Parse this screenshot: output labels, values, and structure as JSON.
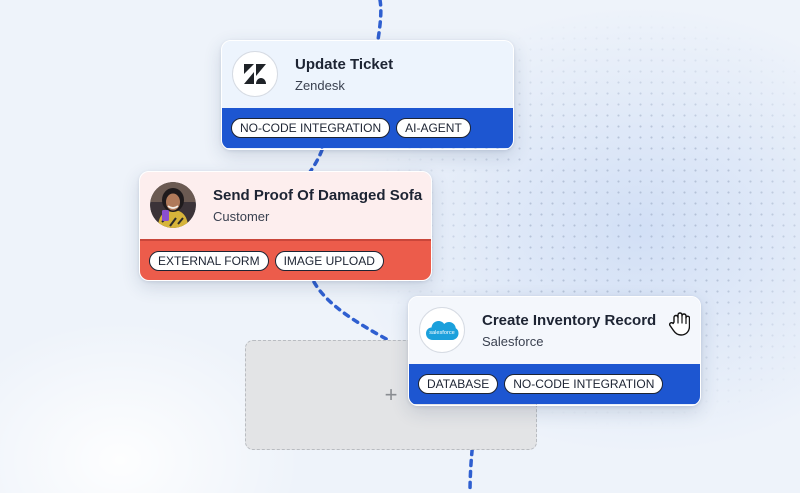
{
  "cards": [
    {
      "title": "Update Ticket",
      "subtitle": "Zendesk",
      "icon": "zendesk-logo-icon",
      "tags": [
        "NO-CODE INTEGRATION",
        "AI-AGENT"
      ],
      "accent": "#1d56d1"
    },
    {
      "title": "Send Proof Of Damaged Sofa",
      "subtitle": "Customer",
      "icon": "customer-avatar",
      "tags": [
        "EXTERNAL FORM",
        "IMAGE UPLOAD"
      ],
      "accent": "#ec5c4b"
    },
    {
      "title": "Create Inventory Record",
      "subtitle": "Salesforce",
      "icon": "salesforce-logo-icon",
      "logo_text": "salesforce",
      "tags": [
        "DATABASE",
        "NO-CODE INTEGRATION"
      ],
      "accent": "#1d56d1"
    }
  ],
  "placeholder": {
    "icon": "plus-icon",
    "symbol": "+"
  },
  "cursor": {
    "icon": "hand-cursor-icon"
  },
  "colors": {
    "connector": "#2f5fd0",
    "background": "#eef3fa"
  }
}
